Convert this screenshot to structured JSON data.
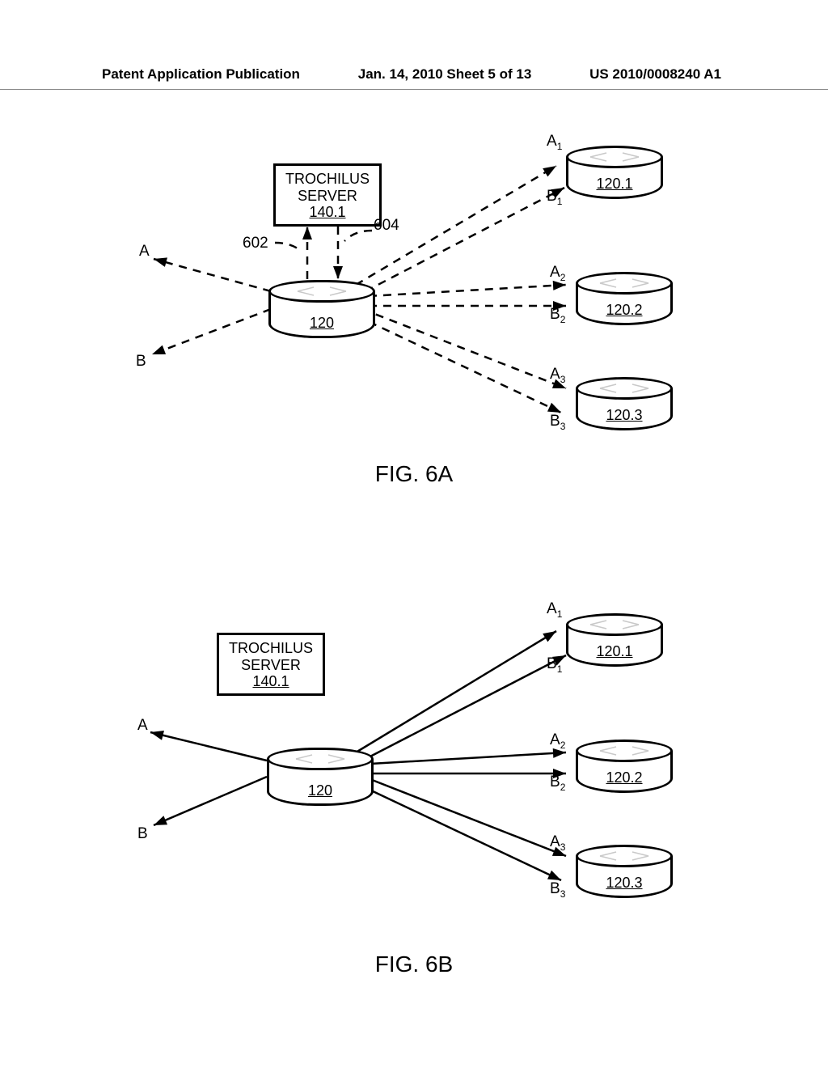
{
  "header": {
    "left": "Patent Application Publication",
    "center": "Jan. 14, 2010  Sheet 5 of 13",
    "right": "US 2010/0008240 A1"
  },
  "server": {
    "line1": "TROCHILUS",
    "line2": "SERVER",
    "ref": "140.1"
  },
  "routers": {
    "main": "120",
    "r1": "120.1",
    "r2": "120.2",
    "r3": "120.3"
  },
  "labels": {
    "A": "A",
    "B": "B",
    "A1": "A",
    "A1s": "1",
    "B1": "B",
    "B1s": "1",
    "A2": "A",
    "A2s": "2",
    "B2": "B",
    "B2s": "2",
    "A3": "A",
    "A3s": "3",
    "B3": "B",
    "B3s": "3",
    "n602": "602",
    "n604": "604"
  },
  "captions": {
    "fig6a": "FIG. 6A",
    "fig6b": "FIG. 6B"
  }
}
